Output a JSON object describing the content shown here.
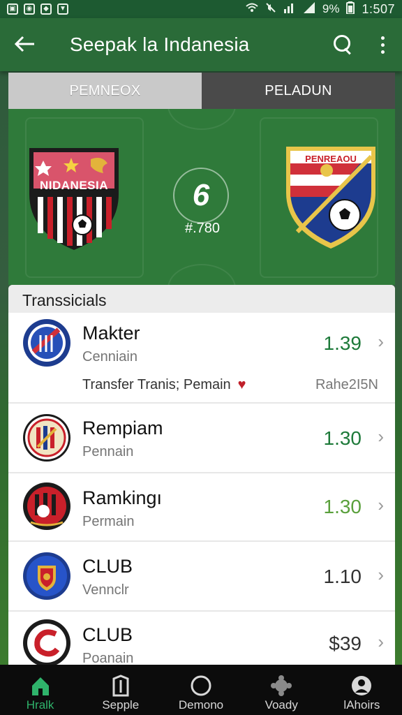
{
  "status_bar": {
    "time": "1:507",
    "battery": "9%",
    "left_icons": [
      "notification-icon",
      "settings-icon",
      "photo-icon",
      "shield-icon"
    ],
    "right_icons": [
      "wifi-icon",
      "mute-icon",
      "signal-icon",
      "signal-icon",
      "battery-icon"
    ]
  },
  "app_bar": {
    "title": "Seepak la Indanesia"
  },
  "tabs": [
    {
      "label": "PEMNEOX",
      "active": true
    },
    {
      "label": "PELADUN",
      "active": false
    }
  ],
  "match": {
    "home_crest_text": "NIDANESIA",
    "away_crest_text": "PENREAOU",
    "center_symbol": "6",
    "score": "#.780"
  },
  "list": {
    "header": "Transsicials",
    "rows": [
      {
        "name": "Makter",
        "sub": "Cenniain",
        "value": "1.39",
        "value_color": "#1e7a3a",
        "detail": "Transfer Tranis; Pemain",
        "detail_right": "Rahe2I5N"
      },
      {
        "name": "Rempiam",
        "sub": "Pennain",
        "value": "1.30",
        "value_color": "#1e7a3a"
      },
      {
        "name": "Ramkingı",
        "sub": "Permain",
        "value": "1.30",
        "value_color": "#5aa03c"
      },
      {
        "name": "CLUB",
        "sub": "Vennclr",
        "value": "1.10",
        "value_color": "#333333"
      },
      {
        "name": "CLUB",
        "sub": "Poanain",
        "value": "$39",
        "value_color": "#333333"
      }
    ]
  },
  "bottom_nav": [
    {
      "label": "Hralk",
      "icon": "home-icon",
      "active": true
    },
    {
      "label": "Sepple",
      "icon": "bookmark-icon",
      "active": false
    },
    {
      "label": "Demono",
      "icon": "circle-icon",
      "active": false
    },
    {
      "label": "Voady",
      "icon": "settings-cog-icon",
      "active": false
    },
    {
      "label": "lAhoirs",
      "icon": "profile-icon",
      "active": false
    }
  ],
  "colors": {
    "app_bar": "#2a6b38",
    "status_bar": "#1d5a31",
    "accent": "#2fb36b",
    "pitch": "#2f7a3a"
  }
}
